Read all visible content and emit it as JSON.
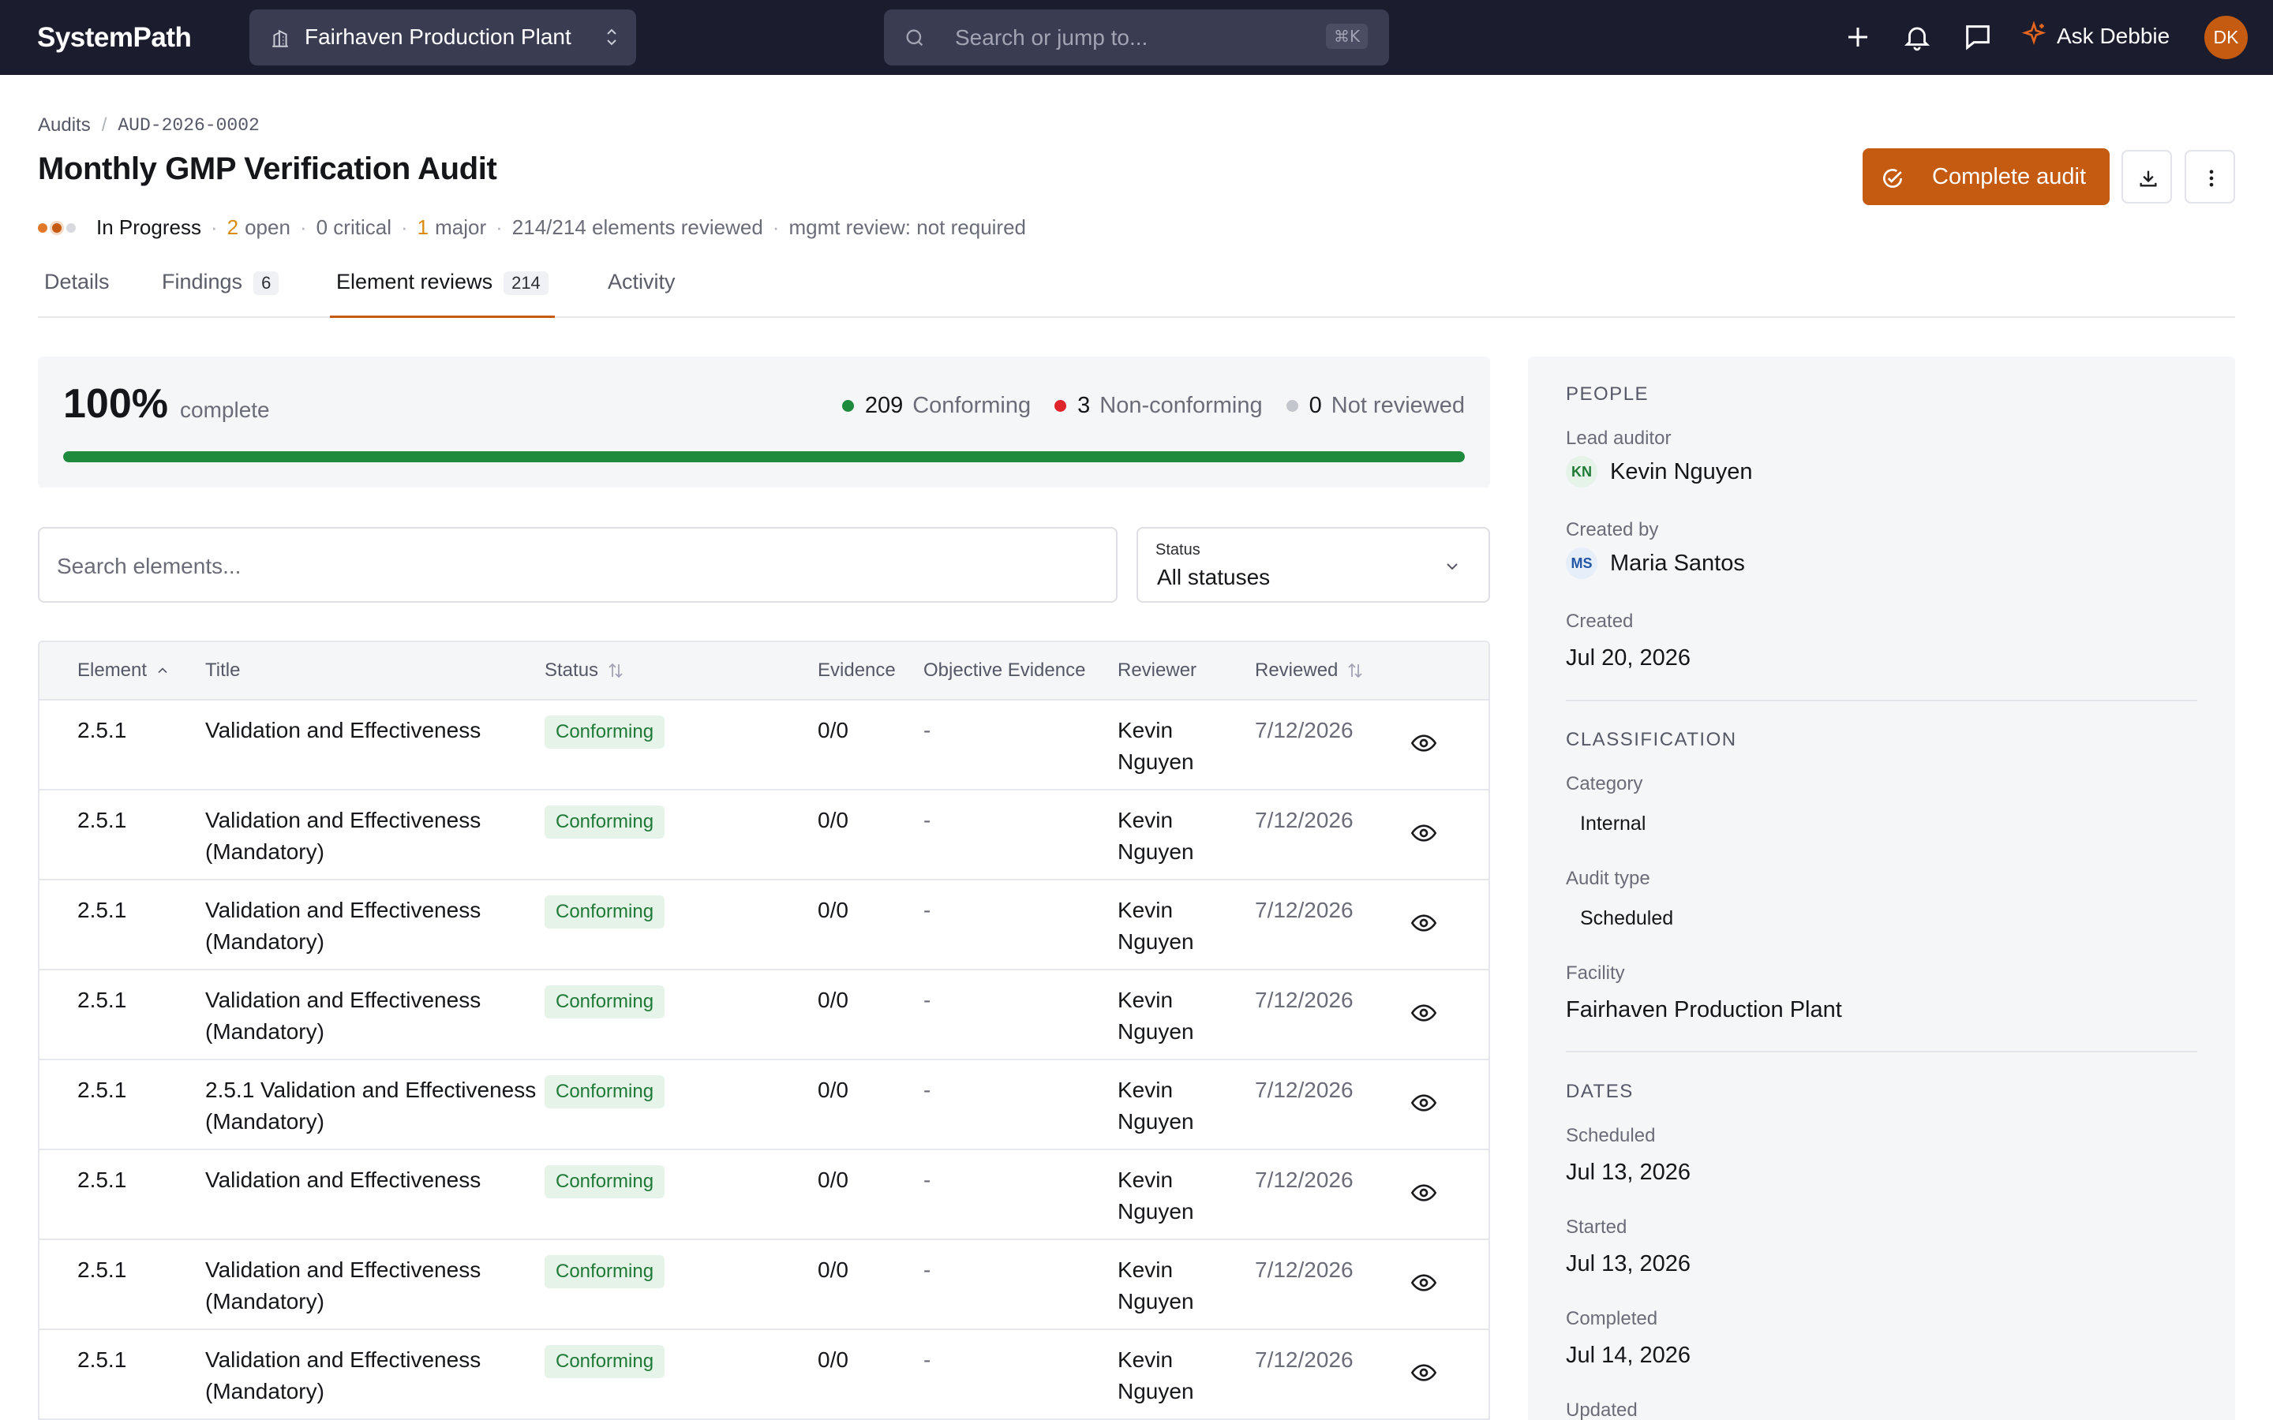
{
  "app": {
    "logo": "SystemPath",
    "facility": "Fairhaven Production Plant",
    "search_placeholder": "Search or jump to...",
    "search_shortcut": "⌘K",
    "ask_label": "Ask Debbie",
    "avatar_initials": "DK",
    "accent_color": "#c55a11"
  },
  "breadcrumb": {
    "root": "Audits",
    "separator": "/",
    "current": "AUD-2026-0002"
  },
  "audit": {
    "title": "Monthly GMP Verification Audit",
    "state": "In Progress",
    "open_count": "2",
    "open_label": "open",
    "critical_text": "0 critical",
    "major_count": "1",
    "major_label": "major",
    "reviewed_text": "214/214 elements reviewed",
    "mgmt_text": "mgmt review: not required",
    "separator": "·"
  },
  "actions": {
    "complete_label": "Complete audit",
    "download_icon": "download-icon",
    "more_icon": "more-vertical-icon"
  },
  "tabs": [
    {
      "label": "Details",
      "count": ""
    },
    {
      "label": "Findings",
      "count": "6"
    },
    {
      "label": "Element reviews",
      "count": "214"
    },
    {
      "label": "Activity",
      "count": ""
    }
  ],
  "progress": {
    "percent_text": "100%",
    "percent_value": 100,
    "label": "complete",
    "conforming_count": "209",
    "conforming_label": "Conforming",
    "nonconforming_count": "3",
    "nonconforming_label": "Non-conforming",
    "notreviewed_count": "0",
    "notreviewed_label": "Not reviewed",
    "colors": {
      "conforming": "#1e8a3c",
      "nonconforming": "#e0242b",
      "notreviewed": "#c4c6cd"
    }
  },
  "filters": {
    "search_placeholder": "Search elements...",
    "status_label": "Status",
    "status_value": "All statuses"
  },
  "table": {
    "headers": {
      "element": "Element",
      "title": "Title",
      "status": "Status",
      "evidence": "Evidence",
      "objective": "Objective Evidence",
      "reviewer": "Reviewer",
      "reviewed": "Reviewed"
    },
    "rows": [
      {
        "element": "2.5.1",
        "title": "Validation and Effectiveness",
        "status": "Conforming",
        "evidence": "0/0",
        "objective": "-",
        "reviewer": "Kevin Nguyen",
        "reviewed": "7/12/2026"
      },
      {
        "element": "2.5.1",
        "title": "Validation and Effectiveness (Mandatory)",
        "status": "Conforming",
        "evidence": "0/0",
        "objective": "-",
        "reviewer": "Kevin Nguyen",
        "reviewed": "7/12/2026"
      },
      {
        "element": "2.5.1",
        "title": "Validation and Effectiveness (Mandatory)",
        "status": "Conforming",
        "evidence": "0/0",
        "objective": "-",
        "reviewer": "Kevin Nguyen",
        "reviewed": "7/12/2026"
      },
      {
        "element": "2.5.1",
        "title": "Validation and Effectiveness (Mandatory)",
        "status": "Conforming",
        "evidence": "0/0",
        "objective": "-",
        "reviewer": "Kevin Nguyen",
        "reviewed": "7/12/2026"
      },
      {
        "element": "2.5.1",
        "title": "2.5.1 Validation and Effectiveness (Mandatory)",
        "status": "Conforming",
        "evidence": "0/0",
        "objective": "-",
        "reviewer": "Kevin Nguyen",
        "reviewed": "7/12/2026"
      },
      {
        "element": "2.5.1",
        "title": "Validation and Effectiveness",
        "status": "Conforming",
        "evidence": "0/0",
        "objective": "-",
        "reviewer": "Kevin Nguyen",
        "reviewed": "7/12/2026"
      },
      {
        "element": "2.5.1",
        "title": "Validation and Effectiveness (Mandatory)",
        "status": "Conforming",
        "evidence": "0/0",
        "objective": "-",
        "reviewer": "Kevin Nguyen",
        "reviewed": "7/12/2026"
      },
      {
        "element": "2.5.1",
        "title": "Validation and Effectiveness (Mandatory)",
        "status": "Conforming",
        "evidence": "0/0",
        "objective": "-",
        "reviewer": "Kevin Nguyen",
        "reviewed": "7/12/2026"
      }
    ]
  },
  "side": {
    "people_heading": "PEOPLE",
    "lead_label": "Lead auditor",
    "lead_initials": "KN",
    "lead_name": "Kevin Nguyen",
    "created_by_label": "Created by",
    "created_by_initials": "MS",
    "created_by_name": "Maria Santos",
    "created_label": "Created",
    "created_value": "Jul 20, 2026",
    "class_heading": "CLASSIFICATION",
    "category_label": "Category",
    "category_value": "Internal",
    "type_label": "Audit type",
    "type_value": "Scheduled",
    "facility_label": "Facility",
    "facility_value": "Fairhaven Production Plant",
    "dates_heading": "DATES",
    "scheduled_label": "Scheduled",
    "scheduled_value": "Jul 13, 2026",
    "started_label": "Started",
    "started_value": "Jul 13, 2026",
    "completed_label": "Completed",
    "completed_value": "Jul 14, 2026",
    "updated_label": "Updated"
  }
}
